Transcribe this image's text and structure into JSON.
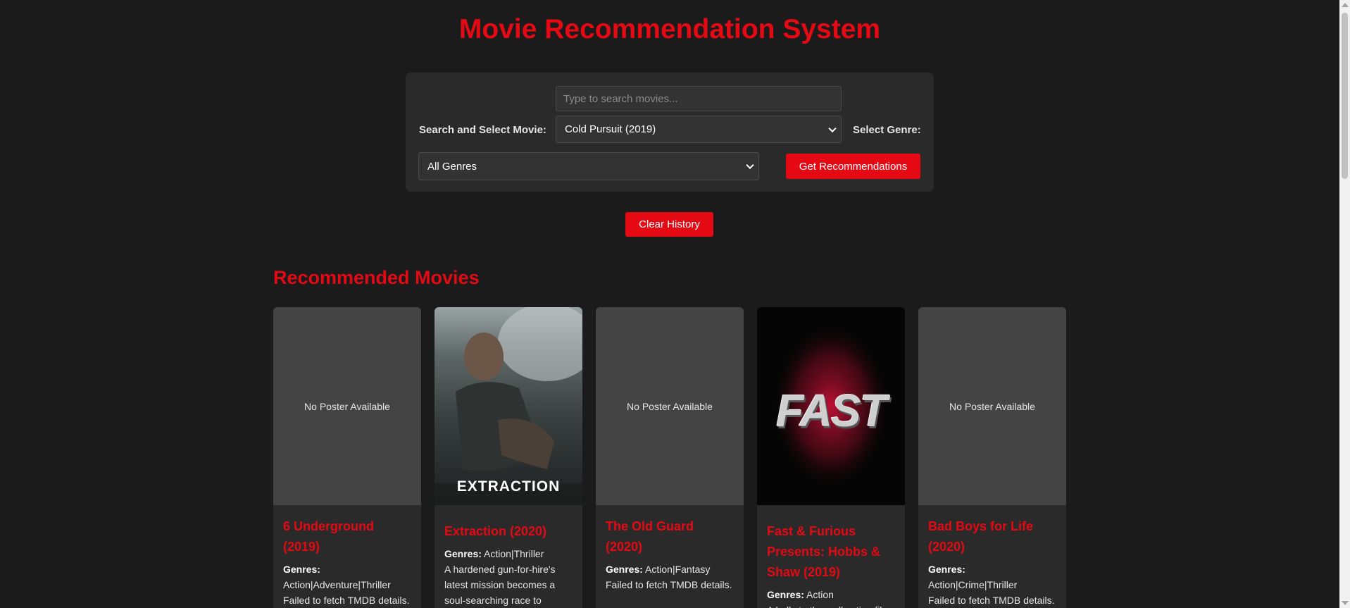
{
  "header": {
    "title": "Movie Recommendation System"
  },
  "controls": {
    "search_placeholder": "Type to search movies...",
    "search_value": "",
    "movie_label": "Search and Select Movie:",
    "movie_selected": "Cold Pursuit (2019)",
    "genre_label": "Select Genre:",
    "genre_selected": "All Genres",
    "recommend_button": "Get Recommendations"
  },
  "clear_history_button": "Clear History",
  "recommendations": {
    "heading": "Recommended Movies",
    "genres_label": "Genres:",
    "movies": [
      {
        "title": "6 Underground (2019)",
        "poster": "No Poster Available",
        "genres": "Action|Adventure|Thriller",
        "description": "Failed to fetch TMDB details."
      },
      {
        "title": "Extraction (2020)",
        "poster": "EXTRACTION",
        "genres": "Action|Thriller",
        "description": "A hardened gun-for-hire's latest mission becomes a soul-searching race to survive"
      },
      {
        "title": "The Old Guard (2020)",
        "poster": "No Poster Available",
        "genres": "Action|Fantasy",
        "description": "Failed to fetch TMDB details."
      },
      {
        "title": "Fast & Furious Presents: Hobbs & Shaw (2019)",
        "poster": "FAST",
        "genres": "Action",
        "description": "A balls to the wall action film"
      },
      {
        "title": "Bad Boys for Life (2020)",
        "poster": "No Poster Available",
        "genres": "Action|Crime|Thriller",
        "description": "Failed to fetch TMDB details."
      }
    ]
  },
  "colors": {
    "accent": "#e50914",
    "background": "#1b1b1b",
    "panel": "#2a2a2a"
  }
}
